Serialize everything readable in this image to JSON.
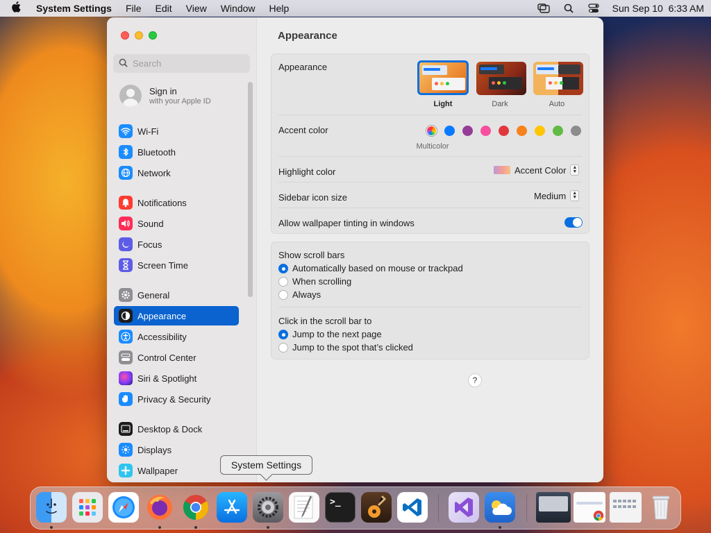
{
  "menubar": {
    "apple_icon": "apple-icon",
    "app_name": "System Settings",
    "menus": [
      "File",
      "Edit",
      "View",
      "Window",
      "Help"
    ],
    "datetime": "Sun Sep 10  6:33 AM"
  },
  "sidebar": {
    "search_placeholder": "Search",
    "signin": {
      "title": "Sign in",
      "subtitle": "with your Apple ID"
    },
    "items": [
      {
        "label": "Wi-Fi",
        "icon": "wifi-icon",
        "color": "#1a8cff"
      },
      {
        "label": "Bluetooth",
        "icon": "bluetooth-icon",
        "color": "#1a8cff"
      },
      {
        "label": "Network",
        "icon": "globe-icon",
        "color": "#1a8cff"
      },
      {
        "label": "Notifications",
        "icon": "bell-icon",
        "color": "#ff3b30"
      },
      {
        "label": "Sound",
        "icon": "speaker-icon",
        "color": "#ff2d55"
      },
      {
        "label": "Focus",
        "icon": "moon-icon",
        "color": "#5e5ce6"
      },
      {
        "label": "Screen Time",
        "icon": "hourglass-icon",
        "color": "#5e5ce6"
      },
      {
        "label": "General",
        "icon": "gear-icon",
        "color": "#8e8e93"
      },
      {
        "label": "Appearance",
        "icon": "appearance-icon",
        "color": "#1c1c1e"
      },
      {
        "label": "Accessibility",
        "icon": "accessibility-icon",
        "color": "#1a8cff"
      },
      {
        "label": "Control Center",
        "icon": "control-center-icon",
        "color": "#8e8e93"
      },
      {
        "label": "Siri & Spotlight",
        "icon": "siri-icon",
        "color": "#7d3cff"
      },
      {
        "label": "Privacy & Security",
        "icon": "hand-icon",
        "color": "#1a8cff"
      },
      {
        "label": "Desktop & Dock",
        "icon": "dock-icon",
        "color": "#1c1c1e"
      },
      {
        "label": "Displays",
        "icon": "display-icon",
        "color": "#1a8cff"
      },
      {
        "label": "Wallpaper",
        "icon": "wallpaper-icon",
        "color": "#2ec5f0"
      }
    ],
    "active": "Appearance"
  },
  "content": {
    "title": "Appearance",
    "appearance": {
      "label": "Appearance",
      "options": [
        "Light",
        "Dark",
        "Auto"
      ],
      "selected": "Light"
    },
    "accent": {
      "label": "Accent color",
      "selected_name": "Multicolor",
      "colors": [
        "multicolor",
        "#0a7aff",
        "#953d96",
        "#f74f9e",
        "#e0383e",
        "#f7821b",
        "#ffc600",
        "#62ba46",
        "#8c8c8c"
      ]
    },
    "highlight": {
      "label": "Highlight color",
      "value": "Accent Color"
    },
    "icon_size": {
      "label": "Sidebar icon size",
      "value": "Medium"
    },
    "tinting": {
      "label": "Allow wallpaper tinting in windows",
      "enabled": true
    },
    "scroll_bars": {
      "label": "Show scroll bars",
      "options": [
        "Automatically based on mouse or trackpad",
        "When scrolling",
        "Always"
      ],
      "selected": 0
    },
    "click_scroll": {
      "label": "Click in the scroll bar to",
      "options": [
        "Jump to the next page",
        "Jump to the spot that’s clicked"
      ],
      "selected": 0
    },
    "help": "?"
  },
  "tooltip": "System Settings",
  "dock": [
    {
      "name": "Finder",
      "icon": "finder-icon",
      "running": true
    },
    {
      "name": "Launchpad",
      "icon": "launchpad-icon",
      "running": false
    },
    {
      "name": "Safari",
      "icon": "safari-icon",
      "running": false
    },
    {
      "name": "Firefox",
      "icon": "firefox-icon",
      "running": true
    },
    {
      "name": "Chrome",
      "icon": "chrome-icon",
      "running": true
    },
    {
      "name": "App Store",
      "icon": "app-store-icon",
      "running": false
    },
    {
      "name": "System Settings",
      "icon": "system-settings-icon",
      "running": true
    },
    {
      "name": "TextEdit",
      "icon": "textedit-icon",
      "running": false
    },
    {
      "name": "Terminal",
      "icon": "terminal-icon",
      "running": false
    },
    {
      "name": "GarageBand",
      "icon": "garageband-icon",
      "running": false
    },
    {
      "name": "Visual Studio Code",
      "icon": "vscode-icon",
      "running": false
    },
    {
      "name": "Visual Studio",
      "icon": "visual-studio-icon",
      "running": false
    },
    {
      "name": "Weather",
      "icon": "weather-icon",
      "running": true
    }
  ]
}
